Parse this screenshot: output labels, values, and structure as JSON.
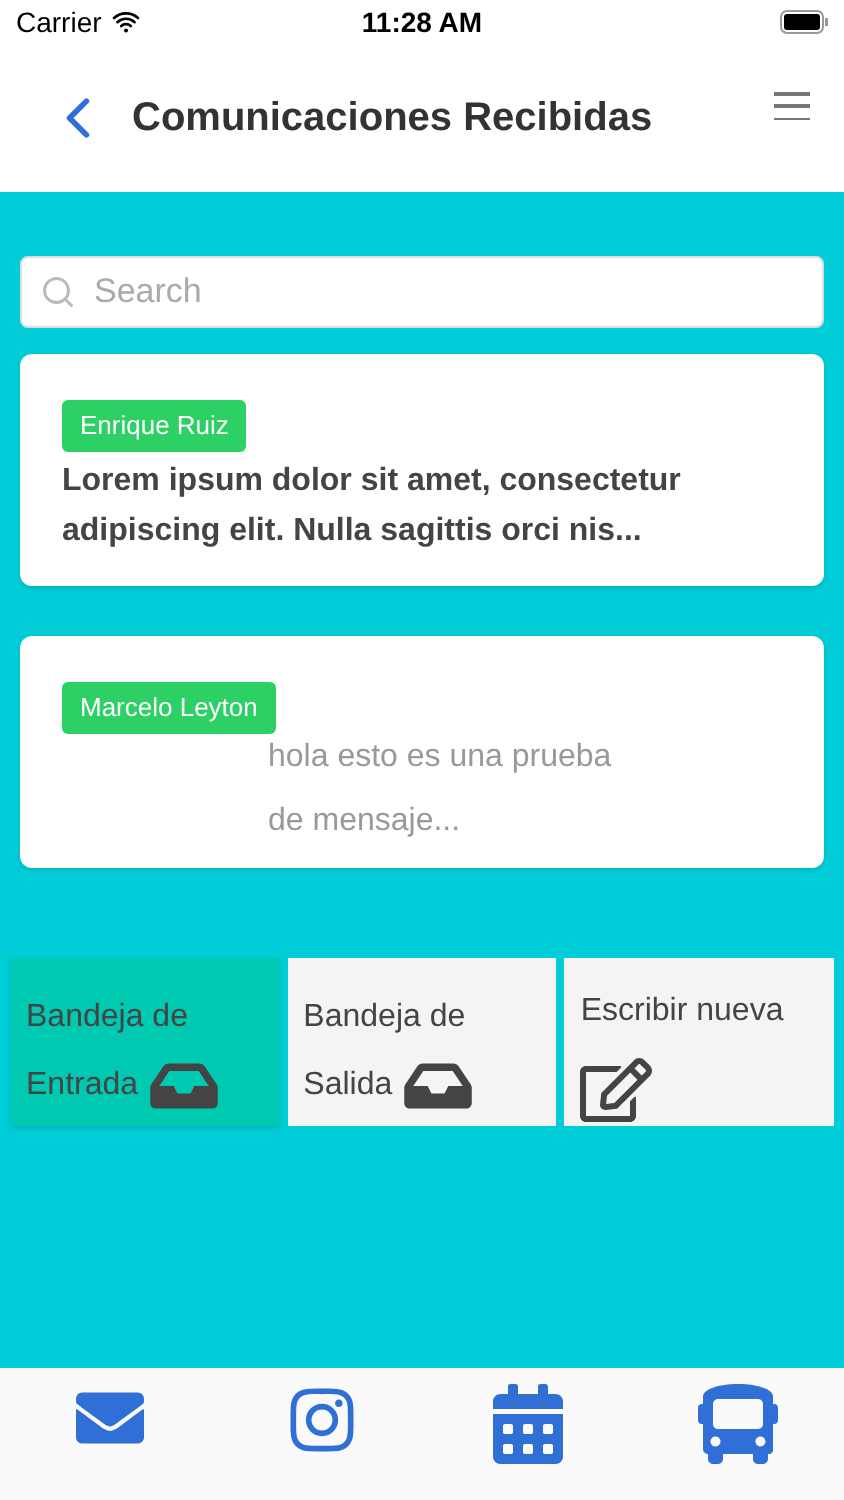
{
  "status_bar": {
    "carrier": "Carrier",
    "time": "11:28 AM"
  },
  "header": {
    "title": "Comunicaciones Recibidas"
  },
  "search": {
    "placeholder": "Search"
  },
  "messages": [
    {
      "sender": "Enrique Ruiz",
      "text": "Lorem ipsum dolor sit amet, consectetur adipiscing elit. Nulla sagittis orci nis...",
      "unread": true
    },
    {
      "sender": "Marcelo Leyton",
      "text": "hola esto es una prueba de mensaje...",
      "unread": false
    }
  ],
  "tiles": [
    {
      "label": "Bandeja de Entrada",
      "kind": "inbox",
      "selected": true
    },
    {
      "label": "Bandeja de Salida",
      "kind": "inbox",
      "selected": false
    },
    {
      "label": "Escribir nueva",
      "kind": "compose",
      "selected": false
    }
  ]
}
